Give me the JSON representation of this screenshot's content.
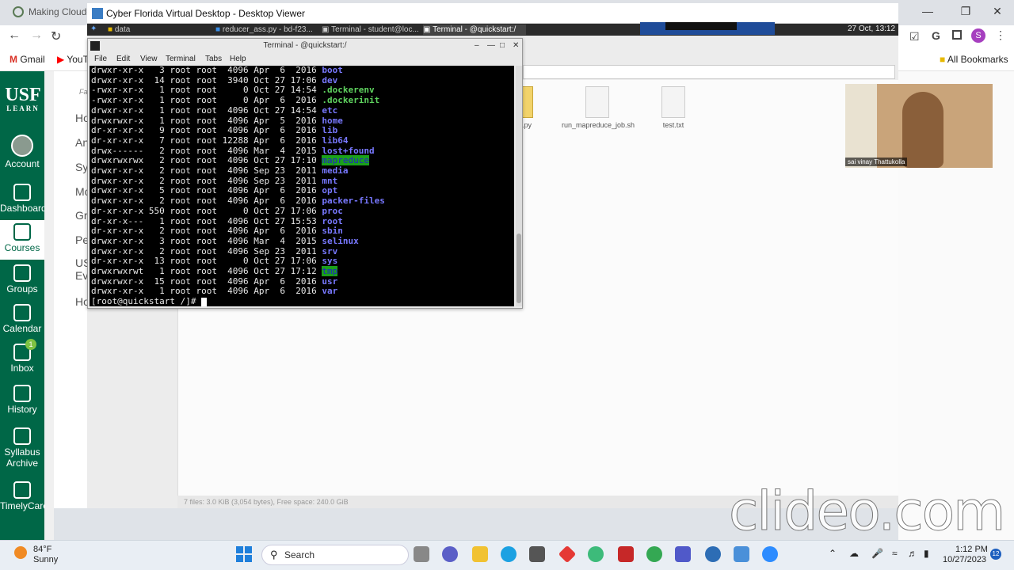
{
  "chrome": {
    "tab_title": "Making Clouderа",
    "bookmarks": [
      "Gmail",
      "YouT"
    ],
    "all_bookmarks": "All Bookmarks",
    "profile_initial": "S"
  },
  "canvas": {
    "logo_main": "USF",
    "logo_sub": "LEARN",
    "nav": [
      {
        "label": "Account"
      },
      {
        "label": "Dashboard"
      },
      {
        "label": "Courses"
      },
      {
        "label": "Groups"
      },
      {
        "label": "Calendar"
      },
      {
        "label": "Inbox",
        "badge": "1"
      },
      {
        "label": "History"
      },
      {
        "label": "Syllabus Archive"
      },
      {
        "label": "TimelyCare"
      }
    ],
    "course_nav": [
      "Ho",
      "An",
      "Sy",
      "Mo",
      "Gr",
      "Pe",
      "US Ev",
      "Ho"
    ],
    "course_nav_top": "Fa"
  },
  "vdi": {
    "title": "Cyber Florida Virtual Desktop - Desktop Viewer",
    "panel_tasks": [
      "data",
      "reducer_ass.py - bd-f23...",
      "Terminal - student@loc...",
      "Terminal - @quickstart:/"
    ],
    "clock": "27 Oct, 13:12"
  },
  "terminal": {
    "title": "Terminal - @quickstart:/",
    "menu": [
      "File",
      "Edit",
      "View",
      "Terminal",
      "Tabs",
      "Help"
    ],
    "rows": [
      {
        "meta": "drwxr-xr-x   3 root root  4096 Apr  6  2016 ",
        "name": "boot",
        "kind": "dir"
      },
      {
        "meta": "drwxr-xr-x  14 root root  3940 Oct 27 17:06 ",
        "name": "dev",
        "kind": "dir"
      },
      {
        "meta": "-rwxr-xr-x   1 root root     0 Oct 27 14:54 ",
        "name": ".dockerenv",
        "kind": "exe"
      },
      {
        "meta": "-rwxr-xr-x   1 root root     0 Apr  6  2016 ",
        "name": ".dockerinit",
        "kind": "exe"
      },
      {
        "meta": "drwxr-xr-x   1 root root  4096 Oct 27 14:54 ",
        "name": "etc",
        "kind": "dir"
      },
      {
        "meta": "drwxrwxr-x   1 root root  4096 Apr  5  2016 ",
        "name": "home",
        "kind": "dir"
      },
      {
        "meta": "dr-xr-xr-x   9 root root  4096 Apr  6  2016 ",
        "name": "lib",
        "kind": "dir"
      },
      {
        "meta": "dr-xr-xr-x   7 root root 12288 Apr  6  2016 ",
        "name": "lib64",
        "kind": "dir"
      },
      {
        "meta": "drwx------   2 root root  4096 Mar  4  2015 ",
        "name": "lost+found",
        "kind": "dir"
      },
      {
        "meta": "drwxrwxrwx   2 root root  4096 Oct 27 17:10 ",
        "name": "mapreduce",
        "kind": "sdir"
      },
      {
        "meta": "drwxr-xr-x   2 root root  4096 Sep 23  2011 ",
        "name": "media",
        "kind": "dir"
      },
      {
        "meta": "drwxr-xr-x   2 root root  4096 Sep 23  2011 ",
        "name": "mnt",
        "kind": "dir"
      },
      {
        "meta": "drwxr-xr-x   5 root root  4096 Apr  6  2016 ",
        "name": "opt",
        "kind": "dir"
      },
      {
        "meta": "drwxr-xr-x   2 root root  4096 Apr  6  2016 ",
        "name": "packer-files",
        "kind": "dir"
      },
      {
        "meta": "dr-xr-xr-x 550 root root     0 Oct 27 17:06 ",
        "name": "proc",
        "kind": "dir"
      },
      {
        "meta": "dr-xr-x---   1 root root  4096 Oct 27 15:53 ",
        "name": "root",
        "kind": "dir"
      },
      {
        "meta": "dr-xr-xr-x   2 root root  4096 Apr  6  2016 ",
        "name": "sbin",
        "kind": "dir"
      },
      {
        "meta": "drwxr-xr-x   3 root root  4096 Mar  4  2015 ",
        "name": "selinux",
        "kind": "dir"
      },
      {
        "meta": "drwxr-xr-x   2 root root  4096 Sep 23  2011 ",
        "name": "srv",
        "kind": "dir"
      },
      {
        "meta": "dr-xr-xr-x  13 root root     0 Oct 27 17:06 ",
        "name": "sys",
        "kind": "dir"
      },
      {
        "meta": "drwxrwxrwt   1 root root  4096 Oct 27 17:12 ",
        "name": "tmp",
        "kind": "sdir"
      },
      {
        "meta": "drwxrwxr-x  15 root root  4096 Apr  6  2016 ",
        "name": "usr",
        "kind": "dir"
      },
      {
        "meta": "drwxr-xr-x   1 root root  4096 Apr  6  2016 ",
        "name": "var",
        "kind": "dir"
      }
    ],
    "prompt": "[root@quickstart /]# "
  },
  "file_manager": {
    "files": [
      "ass.py",
      "run_mapreduce_job.sh",
      "test.txt"
    ],
    "status": "7 files: 3.0 KiB (3,054 bytes), Free space: 240.0 GiB"
  },
  "webcam": {
    "name": "sai vinay Thattukolla"
  },
  "watermark": "clideo.com",
  "taskbar": {
    "temp": "84°F",
    "weather": "Sunny",
    "search_placeholder": "Search",
    "time": "1:12 PM",
    "date": "10/27/2023",
    "notif_count": "12"
  },
  "colors": {
    "usf_green": "#006747",
    "dir_blue": "#7878ff",
    "exe_green": "#5fd35f",
    "sticky_bg": "#1aa01a"
  }
}
